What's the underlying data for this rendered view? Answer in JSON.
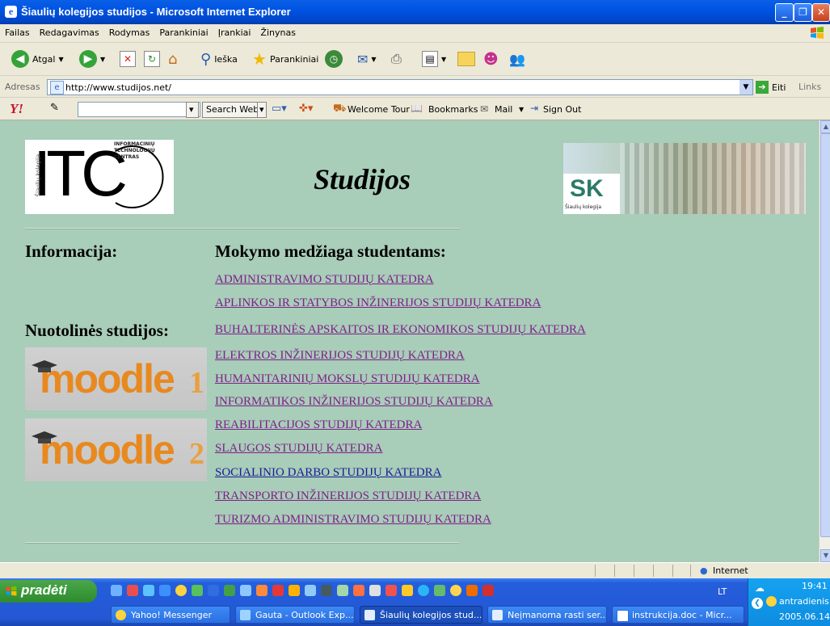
{
  "window": {
    "title": "Šiaulių kolegijos studijos - Microsoft Internet Explorer",
    "ie_glyph": "e",
    "buttons": [
      "_",
      "❐",
      "✕"
    ]
  },
  "menu": [
    "Failas",
    "Redagavimas",
    "Rodymas",
    "Parankiniai",
    "Įrankiai",
    "Žinynas"
  ],
  "toolbar": {
    "back_label": "Atgal",
    "search_label": "Ieška",
    "favorites_label": "Parankiniai"
  },
  "address": {
    "label": "Adresas",
    "url": "http://www.studijos.net/",
    "go_label": "Eiti",
    "links_label": "Links"
  },
  "yahoo": {
    "logo": "Y!",
    "search_button": "Search Web",
    "welcome": "Welcome Tour",
    "bookmarks": "Bookmarks",
    "mail": "Mail",
    "signout": "Sign Out"
  },
  "page": {
    "title": "Studijos",
    "itc_logo_text": "ITC",
    "itc_ring_text": "INFORMACINIŲ TECHNOLOGIJŲ CENTRAS",
    "itc_side_text": "Šiaulių kolegija",
    "sk_logo_text": "SK",
    "sk_caption": "Šiaulių kolegija",
    "info_heading": "Informacija:",
    "materials_heading": "Mokymo medžiaga studentams:",
    "distance_heading": "Nuotolinės studijos:",
    "moodle1": {
      "word": "moodle",
      "num": "1"
    },
    "moodle2": {
      "word": "moodle",
      "num": "2"
    },
    "departments": [
      "ADMINISTRAVIMO STUDIJŲ KATEDRA",
      "APLINKOS IR STATYBOS INŽINERIJOS STUDIJŲ KATEDRA",
      "BUHALTERINĖS APSKAITOS IR EKONOMIKOS STUDIJŲ KATEDRA",
      "ELEKTROS INŽINERIJOS STUDIJŲ KATEDRA",
      "HUMANITARINIŲ MOKSLŲ STUDIJŲ KATEDRA",
      "INFORMATIKOS INŽINERIJOS STUDIJŲ KATEDRA",
      "REABILITACIJOS STUDIJŲ KATEDRA",
      "SLAUGOS STUDIJŲ KATEDRA",
      "SOCIALINIO DARBO STUDIJŲ KATEDRA",
      "TRANSPORTO INŽINERIJOS STUDIJŲ KATEDRA",
      "TURIZMO ADMINISTRAVIMO STUDIJŲ KATEDRA"
    ]
  },
  "status": {
    "zone": "Internet"
  },
  "taskbar": {
    "start": "pradėti",
    "tasks": [
      "Yahoo! Messenger",
      "Gauta - Outlook Exp...",
      "Šiaulių kolegijos stud...",
      "Neįmanoma rasti ser...",
      "instrukcija.doc - Micr..."
    ],
    "lang": "LT",
    "time": "19:41",
    "day": "antradienis",
    "date": "2005.06.14"
  },
  "colors": {
    "page_bg": "#a8cdb8",
    "visited_link": "#7f1f8a",
    "link": "#1a1a9a",
    "taskbar": "#2457d4"
  }
}
